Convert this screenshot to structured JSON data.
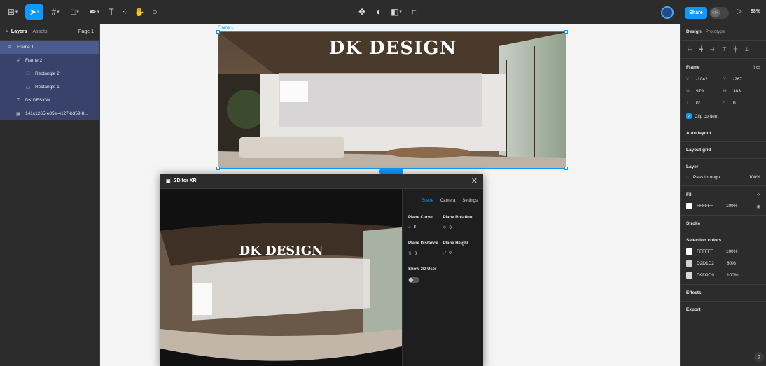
{
  "toolbar": {
    "share_label": "Share",
    "zoom_label": "88%",
    "tools": [
      "main-menu",
      "move",
      "frame",
      "shape",
      "pen",
      "text",
      "resources",
      "hand",
      "comment"
    ]
  },
  "layers_panel": {
    "tab_layers": "Layers",
    "tab_assets": "Assets",
    "page_label": "Page 1",
    "items": [
      {
        "label": "Frame 1",
        "icon": "#",
        "indent": 8,
        "state": "selected"
      },
      {
        "label": "Frame 2",
        "icon": "#",
        "indent": 20,
        "state": "child"
      },
      {
        "label": "Rectangle 2",
        "icon": "□",
        "indent": 34,
        "state": "child"
      },
      {
        "label": "Rectangle 1",
        "icon": "▭",
        "indent": 34,
        "state": "child"
      },
      {
        "label": "DK DESIGN",
        "icon": "T",
        "indent": 20,
        "state": "child"
      },
      {
        "label": "141c1265-e85e-4127-b359-8...",
        "icon": "▣",
        "indent": 20,
        "state": "child"
      }
    ]
  },
  "canvas": {
    "frame_label": "Frame 1",
    "frame_title": "DK DESIGN"
  },
  "plugin": {
    "title": "3D for XR",
    "preview_title": "DK DESIGN",
    "tabs": [
      "Scene",
      "Camera",
      "Settings"
    ],
    "controls": {
      "plane_curve_label": "Plane Curve",
      "plane_curve_value": "8",
      "plane_rotation_label": "Plane Rotation",
      "plane_rotation_value": "0",
      "plane_distance_label": "Plane Distance",
      "plane_distance_value": "0",
      "plane_height_label": "Plane Height",
      "plane_height_value": "0",
      "show_user_label": "Show 3D User"
    }
  },
  "design_panel": {
    "tab_design": "Design",
    "tab_prototype": "Prototype",
    "frame_label": "Frame",
    "x_label": "X",
    "x_value": "-1042",
    "y_label": "Y",
    "y_value": "-267",
    "w_label": "W",
    "w_value": "979",
    "h_label": "H",
    "h_value": "383",
    "rotation_value": "0°",
    "radius_value": "0",
    "clip_content_label": "Clip content",
    "auto_layout_label": "Auto layout",
    "layout_grid_label": "Layout grid",
    "layer_label": "Layer",
    "blend_label": "Pass through",
    "layer_opacity": "100%",
    "fill_label": "Fill",
    "fill_hex": "FFFFFF",
    "fill_opacity": "100%",
    "stroke_label": "Stroke",
    "selection_colors_label": "Selection colors",
    "selection_colors": [
      {
        "hex": "FFFFFF",
        "opacity": "100%",
        "color": "#ffffff"
      },
      {
        "hex": "D2D1D2",
        "opacity": "80%",
        "color": "#d2d1d2"
      },
      {
        "hex": "D9D9D9",
        "opacity": "100%",
        "color": "#d9d9d9"
      }
    ],
    "effects_label": "Effects",
    "export_label": "Export",
    "help_label": "?"
  },
  "colors": {
    "accent": "#0d99ff",
    "panel": "#2c2c2c",
    "canvas": "#f5f5f5"
  }
}
